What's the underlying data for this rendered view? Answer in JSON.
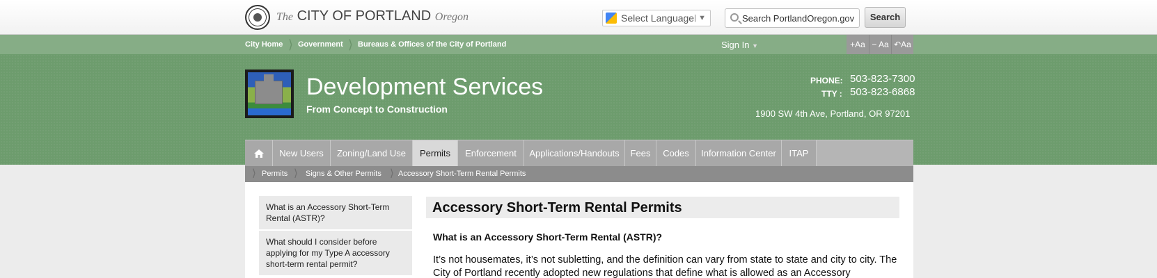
{
  "header": {
    "brand_the": "The",
    "brand_city": "CITY OF PORTLAND",
    "brand_state": "Oregon",
    "language_label": "Select Language",
    "search_placeholder": "Search PortlandOregon.gov",
    "search_button": "Search"
  },
  "breadcrumb_top": [
    "City Home",
    "Government",
    "Bureaus & Offices of the City of Portland"
  ],
  "sign_in": "Sign In",
  "font_controls": [
    "+Aa",
    "− Aa",
    "↶Aa"
  ],
  "site": {
    "title": "Development Services",
    "subtitle": "From Concept to Construction",
    "phone_label": "PHONE:",
    "phone": "503-823-7300",
    "tty_label": "TTY :",
    "tty": "503-823-6868",
    "address": "1900 SW 4th Ave, Portland, OR 97201"
  },
  "nav": [
    "New Users",
    "Zoning/Land Use",
    "Permits",
    "Enforcement",
    "Applications/Handouts",
    "Fees",
    "Codes",
    "Information Center",
    "ITAP"
  ],
  "nav_active": "Permits",
  "subnav": [
    "Permits",
    "Signs & Other Permits",
    "Accessory Short-Term Rental Permits"
  ],
  "sidebar": [
    "What is an Accessory Short-Term Rental (ASTR)?",
    "What should I consider before applying for my Type A accessory short-term rental permit?"
  ],
  "main": {
    "title": "Accessory Short-Term Rental Permits",
    "question": "What is an Accessory Short-Term Rental (ASTR)?",
    "paragraph": "It’s not housemates, it’s not subletting, and the definition can vary from state to state and city to city. The City of Portland recently adopted new regulations that define what is allowed as an Accessory"
  },
  "colors": {
    "green": "#6d9c6d",
    "green_light": "#86ad86",
    "nav_gray": "#a8a8a8"
  }
}
